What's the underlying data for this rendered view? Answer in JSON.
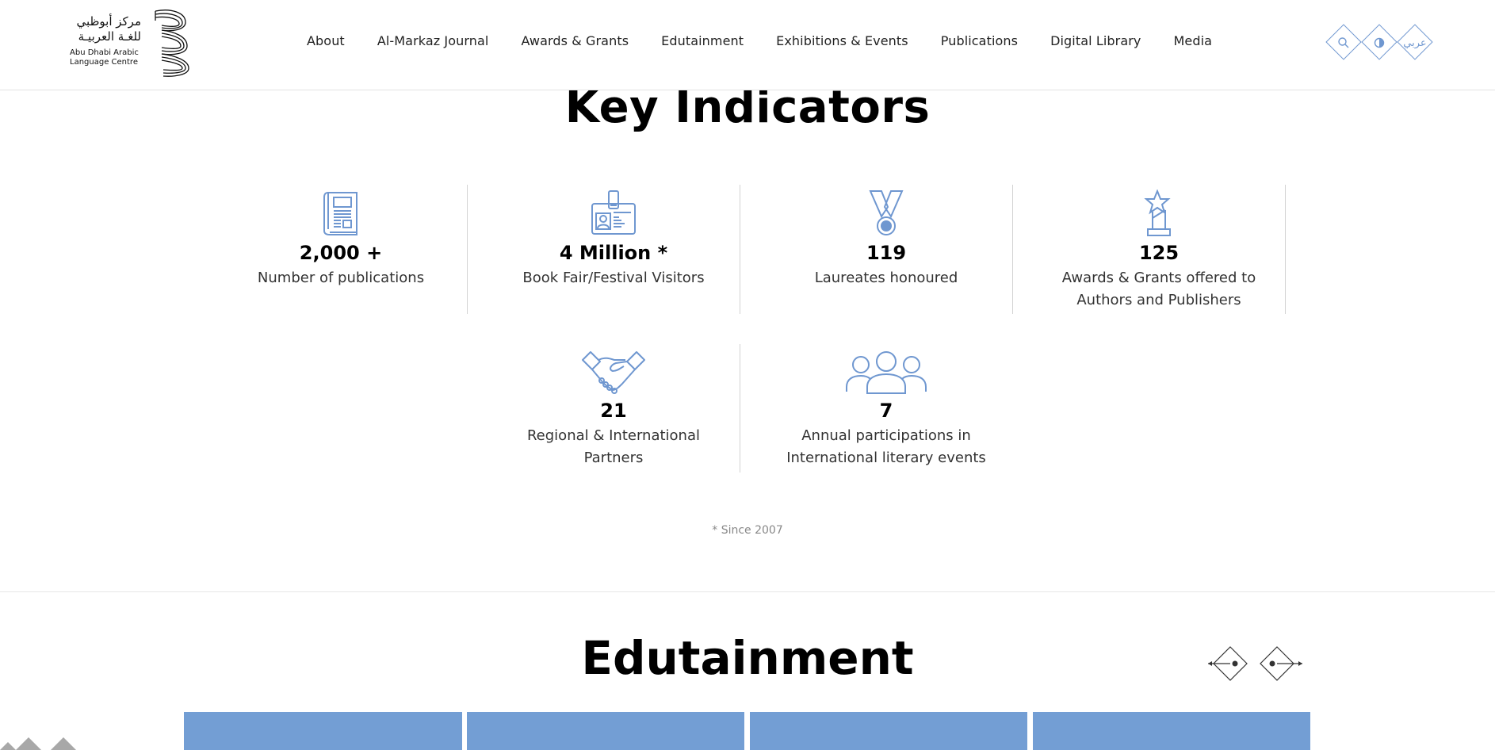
{
  "header": {
    "logo": {
      "arabic_line1": "مركز أبوظبي",
      "arabic_line2": "للغـة العربيـة",
      "english_line1": "Abu Dhabi Arabic",
      "english_line2": "Language Centre"
    },
    "nav": [
      {
        "label": "About"
      },
      {
        "label": "Al-Markaz Journal"
      },
      {
        "label": "Awards & Grants"
      },
      {
        "label": "Edutainment"
      },
      {
        "label": "Exhibitions & Events"
      },
      {
        "label": "Publications"
      },
      {
        "label": "Digital Library"
      },
      {
        "label": "Media"
      }
    ],
    "utilities": {
      "search_icon": "search-icon",
      "contrast_icon": "contrast-icon",
      "language_label": "عربي"
    }
  },
  "key_indicators": {
    "title": "Key Indicators",
    "items": [
      {
        "icon": "publications-icon",
        "value": "2,000 +",
        "label": "Number of publications"
      },
      {
        "icon": "visitor-badge-icon",
        "value": "4 Million *",
        "label": "Book Fair/Festival Visitors"
      },
      {
        "icon": "medal-icon",
        "value": "119",
        "label": "Laureates honoured"
      },
      {
        "icon": "trophy-icon",
        "value": "125",
        "label_line1": "Awards & Grants offered to",
        "label_line2": "Authors and Publishers"
      },
      {
        "icon": "handshake-icon",
        "value": "21",
        "label_line1": "Regional & International",
        "label_line2": "Partners"
      },
      {
        "icon": "people-group-icon",
        "value": "7",
        "label_line1": "Annual participations in",
        "label_line2": "International literary events"
      }
    ],
    "footnote": "* Since 2007"
  },
  "edutainment": {
    "title": "Edutainment",
    "prev_icon": "arrow-left-icon",
    "next_icon": "arrow-right-icon",
    "card_color": "#739ed4"
  },
  "colors": {
    "accent": "#6f97d0",
    "card": "#739ed4",
    "divider": "#d3d3d3"
  }
}
